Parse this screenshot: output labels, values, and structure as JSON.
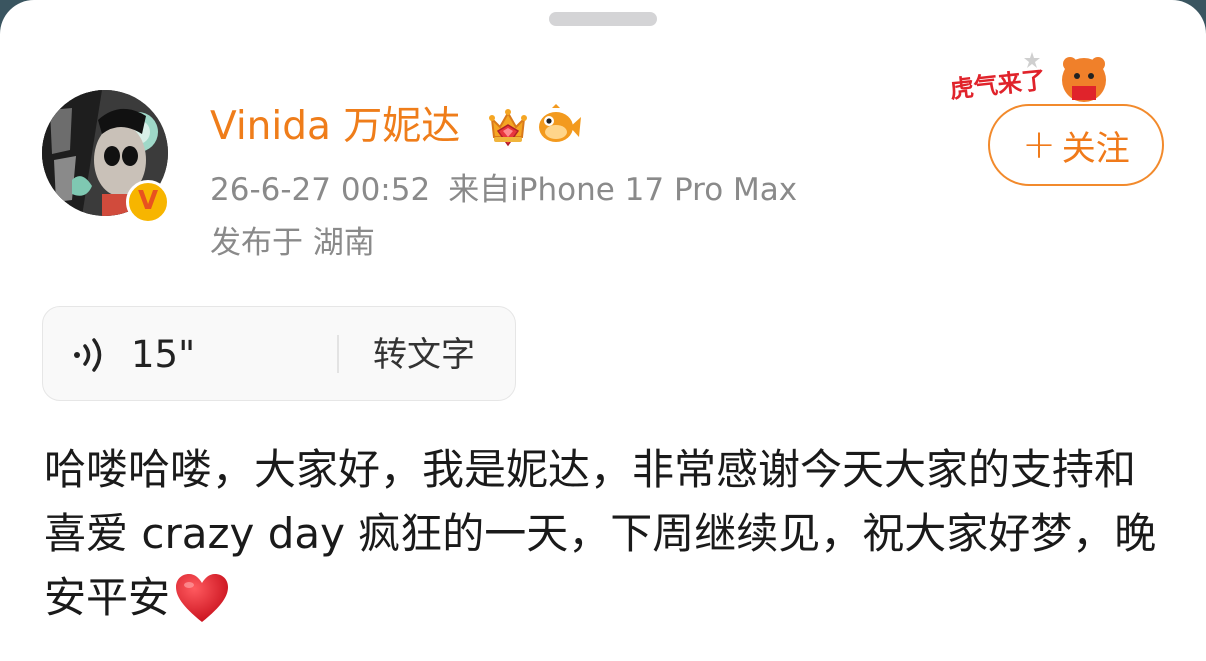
{
  "post": {
    "author": {
      "name": "Vinida 万妮达",
      "verified_badge": "V"
    },
    "meta": {
      "timestamp": "26-6-27 00:52",
      "source": "来自iPhone 17 Pro Max",
      "location": "发布于 湖南"
    },
    "follow_button": {
      "label": "关注"
    },
    "voice": {
      "duration": "15\"",
      "transcribe_label": "转文字"
    },
    "text": "哈喽哈喽，大家好，我是妮达，非常感谢今天大家的支持和喜爱 crazy day 疯狂的一天，下周继续见，祝大家好梦，晚安平安"
  },
  "decor": {
    "tiger_sticker_text": "虎气来了",
    "icons": [
      "avatar",
      "verified-badge-icon",
      "crown-medal-icon",
      "fish-icon",
      "tiger-sticker-icon",
      "plus-icon",
      "voice-wave-icon",
      "heart-icon"
    ],
    "colors": {
      "accent": "#ef7d1a",
      "meta_gray": "#8a8a8a",
      "badge_gold": "#f7b500",
      "heart_red": "#e8202b"
    }
  }
}
